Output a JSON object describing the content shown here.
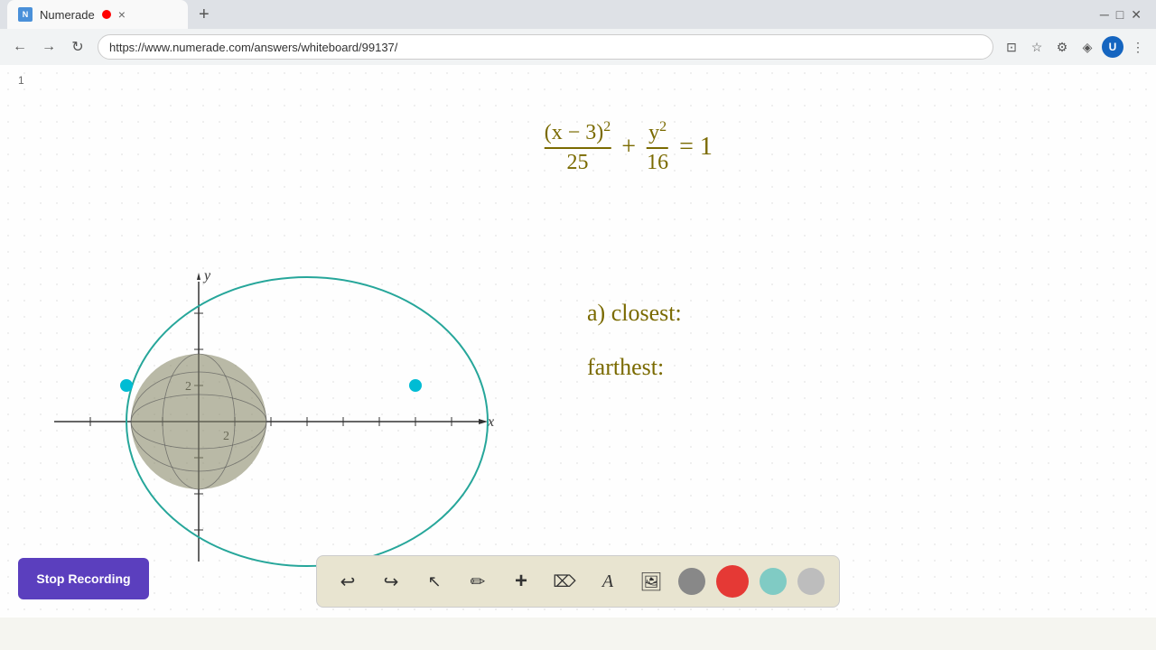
{
  "browser": {
    "tab_title": "Numerade",
    "tab_favicon": "N",
    "url": "https://www.numerade.com/answers/whiteboard/99137/",
    "new_tab_symbol": "+",
    "tab_close_symbol": "×"
  },
  "nav": {
    "back_label": "←",
    "forward_label": "→",
    "refresh_label": "↻"
  },
  "page": {
    "page_number": "1",
    "formula_display": "(x − 3)²/25 + y²/16 = 1",
    "label_a_closest": "a) closest:",
    "label_a_farthest": "farthest:"
  },
  "toolbar": {
    "stop_recording": "Stop Recording",
    "undo_icon": "↩",
    "redo_icon": "↪",
    "select_icon": "▲",
    "pencil_icon": "✏",
    "plus_icon": "+",
    "eraser_icon": "/",
    "text_icon": "A",
    "image_icon": "🖼",
    "colors": {
      "gray": "#888888",
      "red": "#e53935",
      "teal": "#80cbc4",
      "light_gray": "#bdbdbd"
    }
  }
}
